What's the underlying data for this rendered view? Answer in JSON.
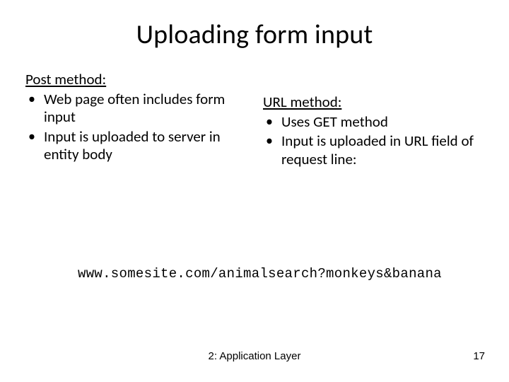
{
  "title": "Uploading form input",
  "left": {
    "heading": "Post method:",
    "bullets": [
      "Web page often includes form input",
      "Input is uploaded to server in entity body"
    ]
  },
  "right": {
    "heading": "URL method:",
    "bullets": [
      "Uses GET method",
      "Input is uploaded in URL field of request line:"
    ]
  },
  "example": "www.somesite.com/animalsearch?monkeys&banana",
  "footer": "2: Application Layer",
  "page": "17"
}
